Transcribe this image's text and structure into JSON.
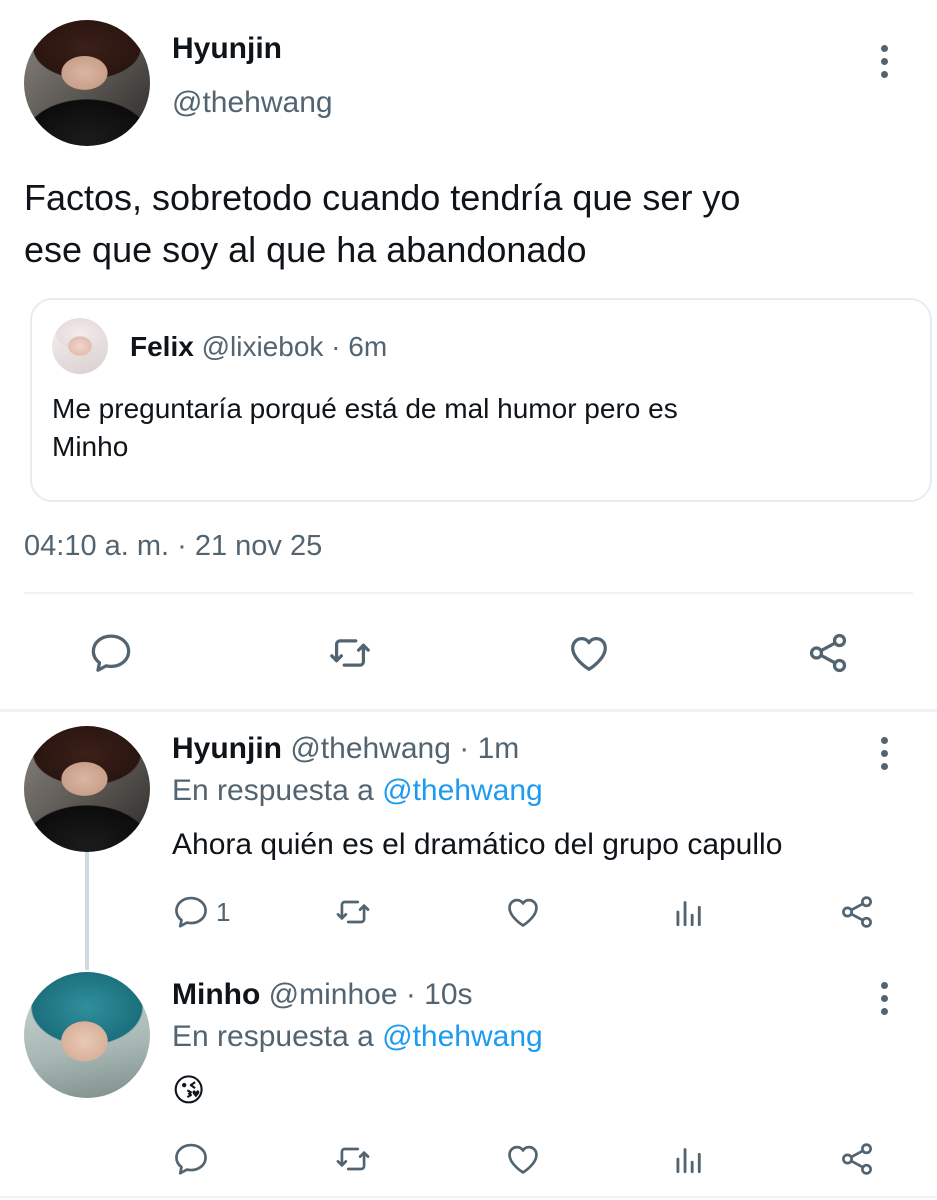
{
  "main_tweet": {
    "author_name": "Hyunjin",
    "author_handle": "@thehwang",
    "text_line1": "Factos, sobretodo cuando tendría que ser yo",
    "text_line2": "ese que soy al que ha abandonado",
    "timestamp": "04:10 a. m. · 21 nov 25",
    "quoted": {
      "author_name": "Felix",
      "meta": "@lixiebok · 6m",
      "text_line1": "Me preguntaría porqué está de mal humor pero es",
      "text_line2": "Minho"
    }
  },
  "replies": [
    {
      "author_name": "Hyunjin",
      "meta": "@thehwang · 1m",
      "reply_prefix": "En respuesta a",
      "reply_to": "@thehwang",
      "text": "Ahora quién es el dramático del grupo capullo",
      "reply_count": "1"
    },
    {
      "author_name": "Minho",
      "meta": "@minhoe · 10s",
      "reply_prefix": "En respuesta a",
      "reply_to": "@thehwang",
      "text": "😘"
    }
  ],
  "icons": {
    "reply": "speech-bubble-icon",
    "retweet": "retweet-arrows-icon",
    "like": "heart-icon",
    "share": "share-nodes-icon",
    "analytics": "bar-chart-icon",
    "more": "kebab-menu-icon"
  },
  "colors": {
    "text": "#0f1419",
    "muted": "#536471",
    "link": "#1d9bf0",
    "border": "#e6ecf0"
  }
}
